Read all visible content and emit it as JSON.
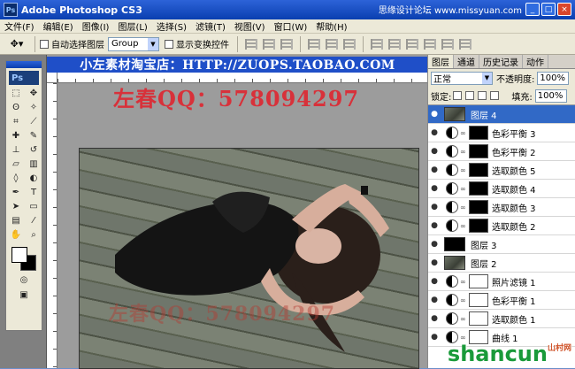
{
  "window": {
    "title": "Adobe Photoshop CS3",
    "app_icon": "Ps",
    "site_tag": "思缘设计论坛  www.missyuan.com",
    "buttons": {
      "minimize": "_",
      "maximize": "□",
      "close": "×"
    }
  },
  "menu": [
    "文件(F)",
    "编辑(E)",
    "图像(I)",
    "图层(L)",
    "选择(S)",
    "滤镜(T)",
    "视图(V)",
    "窗口(W)",
    "帮助(H)"
  ],
  "options": {
    "tool_icon": "move-tool-icon",
    "auto_select_label": "自动选择图层",
    "auto_select_value": "Group",
    "show_transform_label": "显示变换控件"
  },
  "toolbox": {
    "logo": "Ps"
  },
  "document": {
    "banner": "小左素材淘宝店：HTTP://ZUOPS.TAOBAO.COM",
    "watermark_top": "左春QQ：578094297",
    "watermark_bottom": "左春QQ：578094297"
  },
  "layers_panel": {
    "tabs": [
      "图层",
      "通道",
      "历史记录",
      "动作"
    ],
    "blend_mode": "正常",
    "opacity_label": "不透明度:",
    "opacity_value": "100%",
    "lock_label": "锁定:",
    "fill_label": "填充:",
    "fill_value": "100%",
    "layers": [
      {
        "name": "图层 4",
        "kind": "image",
        "selected": true
      },
      {
        "name": "色彩平衡 3",
        "kind": "adjust",
        "mask": "black"
      },
      {
        "name": "色彩平衡 2",
        "kind": "adjust",
        "mask": "black"
      },
      {
        "name": "选取颜色 5",
        "kind": "adjust",
        "mask": "black"
      },
      {
        "name": "选取颜色 4",
        "kind": "adjust",
        "mask": "black"
      },
      {
        "name": "选取颜色 3",
        "kind": "adjust",
        "mask": "black"
      },
      {
        "name": "选取颜色 2",
        "kind": "adjust",
        "mask": "black"
      },
      {
        "name": "图层 3",
        "kind": "image-dark"
      },
      {
        "name": "图层 2",
        "kind": "image"
      },
      {
        "name": "照片滤镜 1",
        "kind": "adjust",
        "mask": "white"
      },
      {
        "name": "色彩平衡 1",
        "kind": "adjust",
        "mask": "white"
      },
      {
        "name": "选取颜色 1",
        "kind": "adjust",
        "mask": "white"
      },
      {
        "name": "曲线 1",
        "kind": "adjust",
        "mask": "white"
      }
    ]
  },
  "logo_mark": {
    "text": "shancun",
    "suffix": "山村网"
  }
}
